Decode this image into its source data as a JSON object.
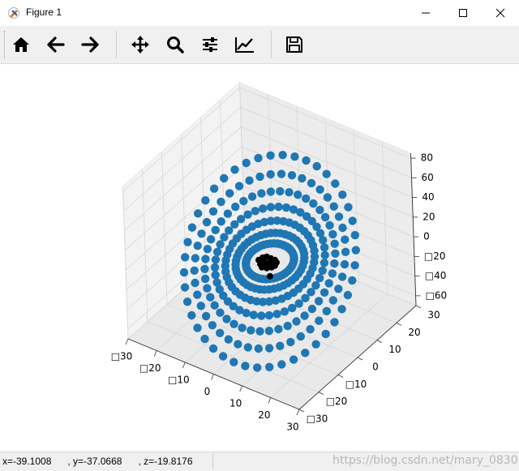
{
  "window": {
    "title": "Figure 1",
    "icons": [
      "figure-app-icon",
      "minimize-icon",
      "maximize-icon",
      "close-icon"
    ]
  },
  "toolbar": {
    "buttons": [
      {
        "name": "home-button",
        "icon": "home-icon"
      },
      {
        "name": "back-button",
        "icon": "arrow-left-icon"
      },
      {
        "name": "forward-button",
        "icon": "arrow-right-icon"
      },
      {
        "name": "pan-button",
        "icon": "move-icon"
      },
      {
        "name": "zoom-button",
        "icon": "magnifier-icon"
      },
      {
        "name": "subplots-button",
        "icon": "sliders-icon"
      },
      {
        "name": "edit-axes-button",
        "icon": "line-chart-icon"
      },
      {
        "name": "save-button",
        "icon": "floppy-disk-icon"
      }
    ]
  },
  "statusbar": {
    "coords": "x=-39.1008      , y=-37.0668      , z=-19.8176",
    "watermark": "https://blog.csdn.net/mary_0830"
  },
  "colors": {
    "points": "#1f77b4",
    "cluster": "#000000",
    "pane": "#f2f2f2"
  },
  "chart_data": {
    "type": "scatter",
    "projection": "3d",
    "grid": true,
    "title": "",
    "xlabel": "",
    "ylabel": "",
    "zlabel": "",
    "x_ticks": [
      "□30",
      "□20",
      "□10",
      "0",
      "10",
      "20",
      "30"
    ],
    "y_ticks": [
      "□30",
      "□20",
      "□10",
      "0",
      "10",
      "20",
      "30"
    ],
    "z_ticks": [
      "80",
      "60",
      "40",
      "20",
      "0",
      "□20",
      "□40",
      "□60"
    ],
    "xlim": [
      -30,
      30
    ],
    "ylim": [
      -30,
      30
    ],
    "zlim": [
      -70,
      85
    ],
    "series": [
      {
        "color": "#1f77b4",
        "description": "blue rings of points forming a curved ring-shaped surface",
        "ring_radii": [
          7,
          10,
          13,
          16,
          19,
          22,
          25
        ],
        "points_per_ring": 44
      },
      {
        "color": "#000000",
        "description": "small black cluster near the center",
        "center": [
          0,
          0,
          -10
        ]
      }
    ]
  }
}
